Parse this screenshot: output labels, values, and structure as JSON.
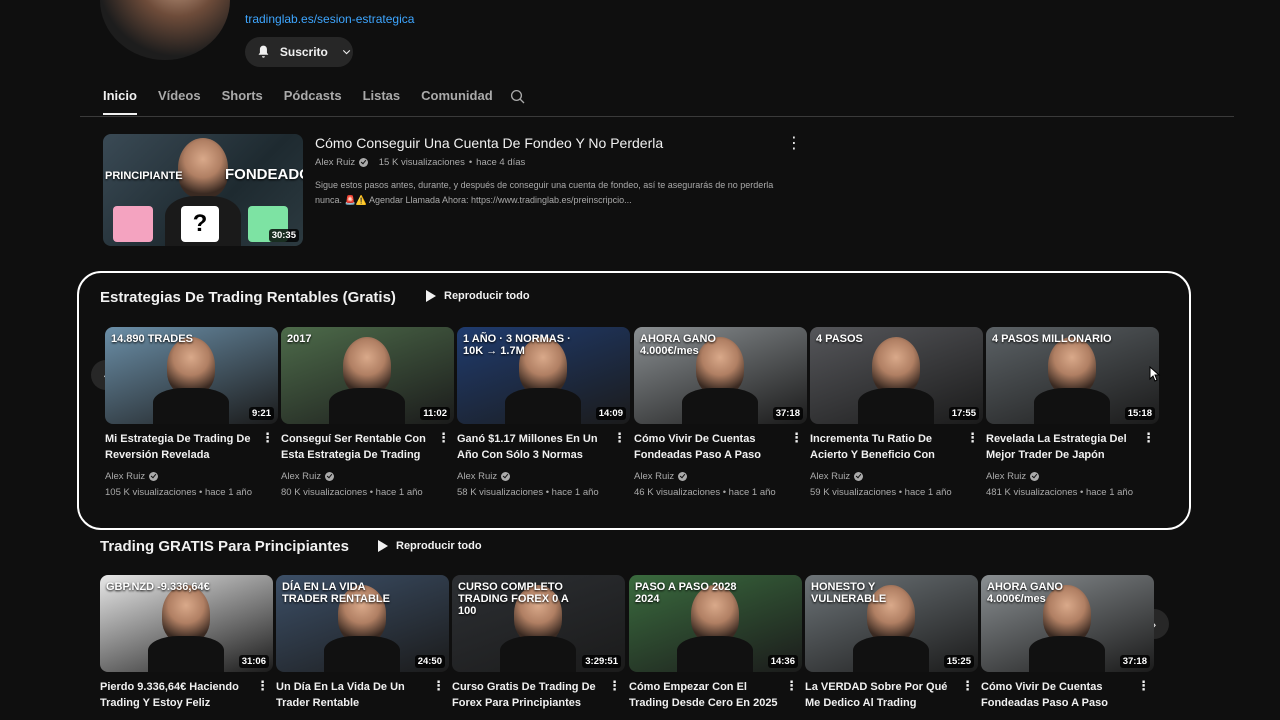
{
  "channel": {
    "link": "tradinglab.es/sesion-estrategica",
    "subscribed_label": "Suscrito"
  },
  "tabs": [
    "Inicio",
    "Vídeos",
    "Shorts",
    "Pódcasts",
    "Listas",
    "Comunidad"
  ],
  "featured": {
    "title": "Cómo Conseguir Una Cuenta De Fondeo Y No Perderla",
    "author": "Alex Ruiz",
    "views": "15 K visualizaciones",
    "age": "hace 4 días",
    "description": "Sigue estos pasos antes, durante, y después de conseguir una cuenta de fondeo, así te asegurarás de no perderla nunca. 🚨⚠️ Agendar Llamada Ahora: https://www.tradinglab.es/preinscripcio...",
    "duration": "30:35",
    "thumb_left_text": "PRINCIPIANTE",
    "thumb_right_text": "FONDEADO"
  },
  "shelf1": {
    "title": "Estrategias De Trading Rentables (Gratis)",
    "play_all": "Reproducir todo",
    "videos": [
      {
        "title": "Mi Estrategia De Trading De Reversión Revelada",
        "author": "Alex Ruiz",
        "views": "105 K visualizaciones • hace 1 año",
        "duration": "9:21",
        "overlay": "14.890 TRADES",
        "bg": "#6b8fa8"
      },
      {
        "title": "Conseguí Ser Rentable Con Esta Estrategia De Trading",
        "author": "Alex Ruiz",
        "views": "80 K visualizaciones • hace 1 año",
        "duration": "11:02",
        "overlay": "2017",
        "bg": "#4d6b4a"
      },
      {
        "title": "Ganó $1.17 Millones En Un Año Con Sólo 3 Normas",
        "author": "Alex Ruiz",
        "views": "58 K visualizaciones • hace 1 año",
        "duration": "14:09",
        "overlay": "1 AÑO · 3 NORMAS · 10K → 1.7M",
        "bg": "#1f3b6e"
      },
      {
        "title": "Cómo Vivir De Cuentas Fondeadas Paso A Paso",
        "author": "Alex Ruiz",
        "views": "46 K visualizaciones • hace 1 año",
        "duration": "37:18",
        "overlay": "AHORA GANO 4.000€/mes",
        "bg": "#8a8f92"
      },
      {
        "title": "Incrementa Tu Ratio De Acierto Y Beneficio Con Est...",
        "author": "Alex Ruiz",
        "views": "59 K visualizaciones • hace 1 año",
        "duration": "17:55",
        "overlay": "4 PASOS",
        "bg": "#55565a"
      },
      {
        "title": "Revelada La Estrategia Del Mejor Trader De Japón",
        "author": "Alex Ruiz",
        "views": "481 K visualizaciones • hace 1 año",
        "duration": "15:18",
        "overlay": "4 PASOS MILLONARIO",
        "bg": "#5c6266"
      }
    ]
  },
  "shelf2": {
    "title": "Trading GRATIS Para Principiantes",
    "play_all": "Reproducir todo",
    "videos": [
      {
        "title": "Pierdo 9.336,64€ Haciendo Trading Y Estoy Feliz",
        "duration": "31:06",
        "overlay": "GBP.NZD -9.336,64€",
        "bg": "#e8e8e8"
      },
      {
        "title": "Un Día En La Vida De Un Trader Rentable",
        "duration": "24:50",
        "overlay": "DÍA EN LA VIDA TRADER RENTABLE",
        "bg": "#3c4f67"
      },
      {
        "title": "Curso Gratis De Trading De Forex Para Principiantes",
        "duration": "3:29:51",
        "overlay": "CURSO COMPLETO TRADING FOREX 0 A 100",
        "bg": "#2c2f33"
      },
      {
        "title": "Cómo Empezar Con El Trading Desde Cero En 2025",
        "duration": "14:36",
        "overlay": "PASO A PASO 2028 2024",
        "bg": "#3a6b3e"
      },
      {
        "title": "La VERDAD Sobre Por Qué Me Dedico Al Trading",
        "duration": "15:25",
        "overlay": "HONESTO Y VULNERABLE",
        "bg": "#6d7478"
      },
      {
        "title": "Cómo Vivir De Cuentas Fondeadas Paso A Paso",
        "duration": "37:18",
        "overlay": "AHORA GANO 4.000€/mes",
        "bg": "#8a8f92"
      }
    ]
  }
}
